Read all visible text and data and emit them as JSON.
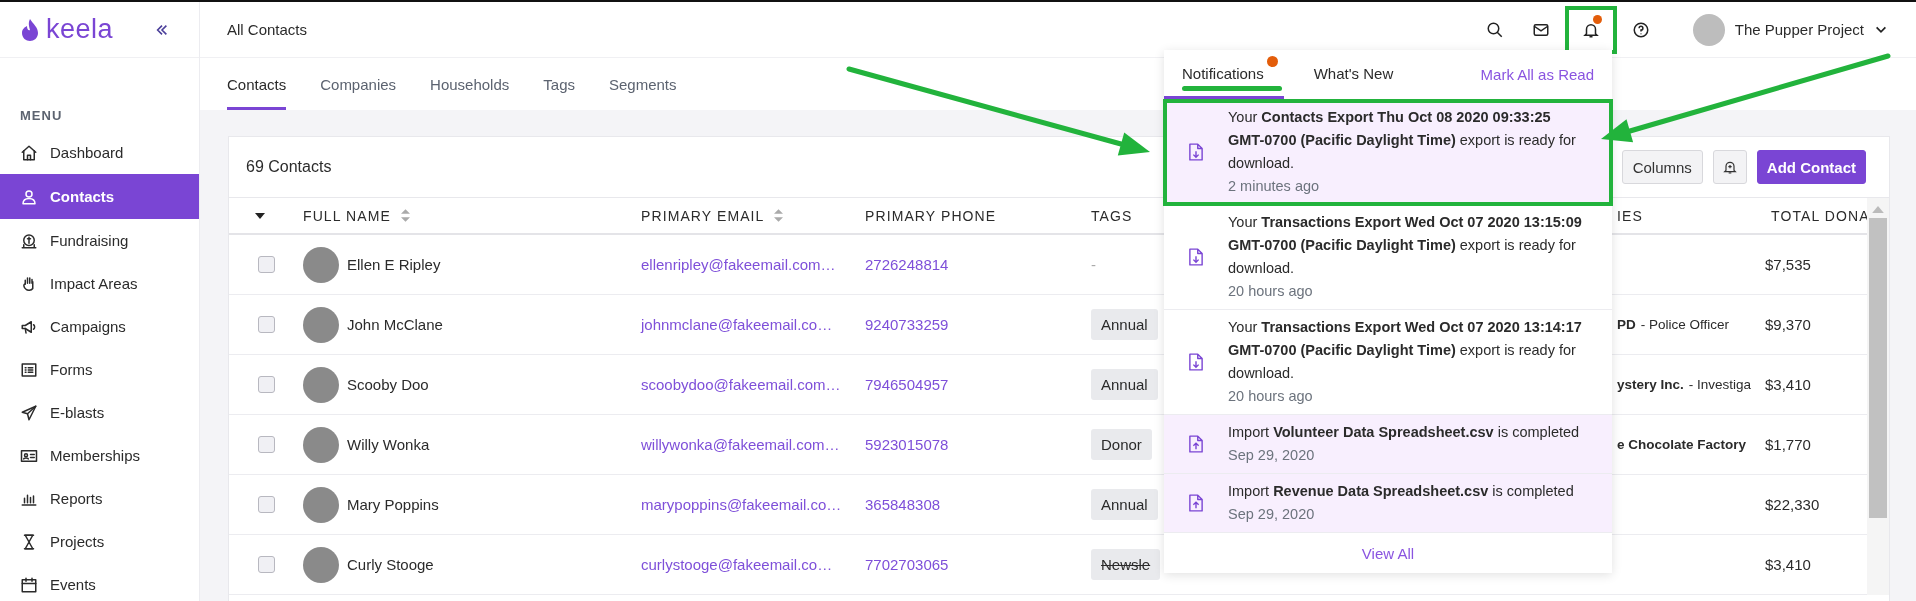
{
  "sidebar": {
    "logo": "keela",
    "menu_heading": "MENU",
    "items": [
      {
        "label": "Dashboard",
        "selected": false
      },
      {
        "label": "Contacts",
        "selected": true
      },
      {
        "label": "Fundraising",
        "selected": false
      },
      {
        "label": "Impact Areas",
        "selected": false
      },
      {
        "label": "Campaigns",
        "selected": false
      },
      {
        "label": "Forms",
        "selected": false
      },
      {
        "label": "E-blasts",
        "selected": false
      },
      {
        "label": "Memberships",
        "selected": false
      },
      {
        "label": "Reports",
        "selected": false
      },
      {
        "label": "Projects",
        "selected": false
      },
      {
        "label": "Events",
        "selected": false
      }
    ]
  },
  "header": {
    "title": "All Contacts",
    "bell": {
      "has_unread": true,
      "annotated": true
    },
    "account": "The Pupper Project"
  },
  "tabs": [
    {
      "label": "Contacts",
      "selected": true
    },
    {
      "label": "Companies",
      "selected": false
    },
    {
      "label": "Households",
      "selected": false
    },
    {
      "label": "Tags",
      "selected": false
    },
    {
      "label": "Segments",
      "selected": false
    }
  ],
  "contacts": {
    "count": "69 Contacts",
    "columns_button": "Columns",
    "add_button": "Add Contact"
  },
  "table": {
    "columns": [
      {
        "label": "FULL NAME",
        "sortable": true
      },
      {
        "label": "PRIMARY EMAIL",
        "sortable": true
      },
      {
        "label": "PRIMARY PHONE",
        "sortable": false
      },
      {
        "label": "TAGS",
        "sortable": false
      },
      {
        "label": "IES",
        "sortable": false
      },
      {
        "label": "TOTAL DONA",
        "sortable": false
      }
    ],
    "rows": [
      {
        "checked": false,
        "name": "Ellen E Ripley",
        "email": "ellenripley@fakeemail.com…",
        "phone": "2726248814",
        "tag": {
          "kind": "empty",
          "label": "-"
        },
        "total": "$7,535"
      },
      {
        "checked": false,
        "name": "John McClane",
        "email": "johnmclane@fakeemail.co…",
        "phone": "9240733259",
        "tag": {
          "kind": "chip",
          "label": "Annual",
          "struck": false
        },
        "company": {
          "name": "PD",
          "role": "- Police Officer"
        },
        "total": "$9,370"
      },
      {
        "checked": false,
        "name": "Scooby Doo",
        "email": "scoobydoo@fakeemail.com…",
        "phone": "7946504957",
        "tag": {
          "kind": "chip",
          "label": "Annual",
          "struck": false
        },
        "company": {
          "name": "ystery Inc.",
          "role": "- Investiga"
        },
        "total": "$3,410"
      },
      {
        "checked": false,
        "name": "Willy Wonka",
        "email": "willywonka@fakeemail.com…",
        "phone": "5923015078",
        "tag": {
          "kind": "chip",
          "label": "Donor",
          "struck": false
        },
        "company": {
          "name": "e Chocolate Factory"
        },
        "total": "$1,770"
      },
      {
        "checked": false,
        "name": "Mary Poppins",
        "email": "marypoppins@fakeemail.co…",
        "phone": "365848308",
        "tag": {
          "kind": "chip",
          "label": "Annual",
          "struck": false
        },
        "total": "$22,330"
      },
      {
        "checked": false,
        "name": "Curly Stooge",
        "email": "curlystooge@fakeemail.co…",
        "phone": "7702703065",
        "tag": {
          "kind": "chip",
          "label": "Newsle",
          "struck": true
        },
        "total": "$3,410"
      }
    ]
  },
  "notifications": {
    "tabs": [
      {
        "label": "Notifications",
        "selected": true,
        "has_unread": true,
        "annotated": true
      },
      {
        "label": "What's New",
        "selected": false,
        "has_unread": false,
        "annotated": false
      }
    ],
    "mark_all": "Mark All as Read",
    "items": [
      {
        "kind": "export",
        "unread": true,
        "annotated": true,
        "text": "Your **Contacts Export Thu Oct 08 2020 09:33:25 GMT-0700 (Pacific Daylight Time)** export is ready for download.",
        "time": "2 minutes ago"
      },
      {
        "kind": "export",
        "unread": false,
        "annotated": false,
        "text": "Your **Transactions Export Wed Oct 07 2020 13:15:09 GMT-0700 (Pacific Daylight Time)** export is ready for download.",
        "time": "20 hours ago"
      },
      {
        "kind": "export",
        "unread": false,
        "annotated": false,
        "text": "Your **Transactions Export Wed Oct 07 2020 13:14:17 GMT-0700 (Pacific Daylight Time)** export is ready for download.",
        "time": "20 hours ago"
      },
      {
        "kind": "import",
        "unread": true,
        "annotated": false,
        "text": "Import **Volunteer Data Spreadsheet.csv** is completed",
        "time": "Sep 29, 2020"
      },
      {
        "kind": "import",
        "unread": true,
        "annotated": false,
        "text": "Import **Revenue Data Spreadsheet.csv** is completed",
        "time": "Sep 29, 2020"
      }
    ],
    "view_all": "View All"
  }
}
